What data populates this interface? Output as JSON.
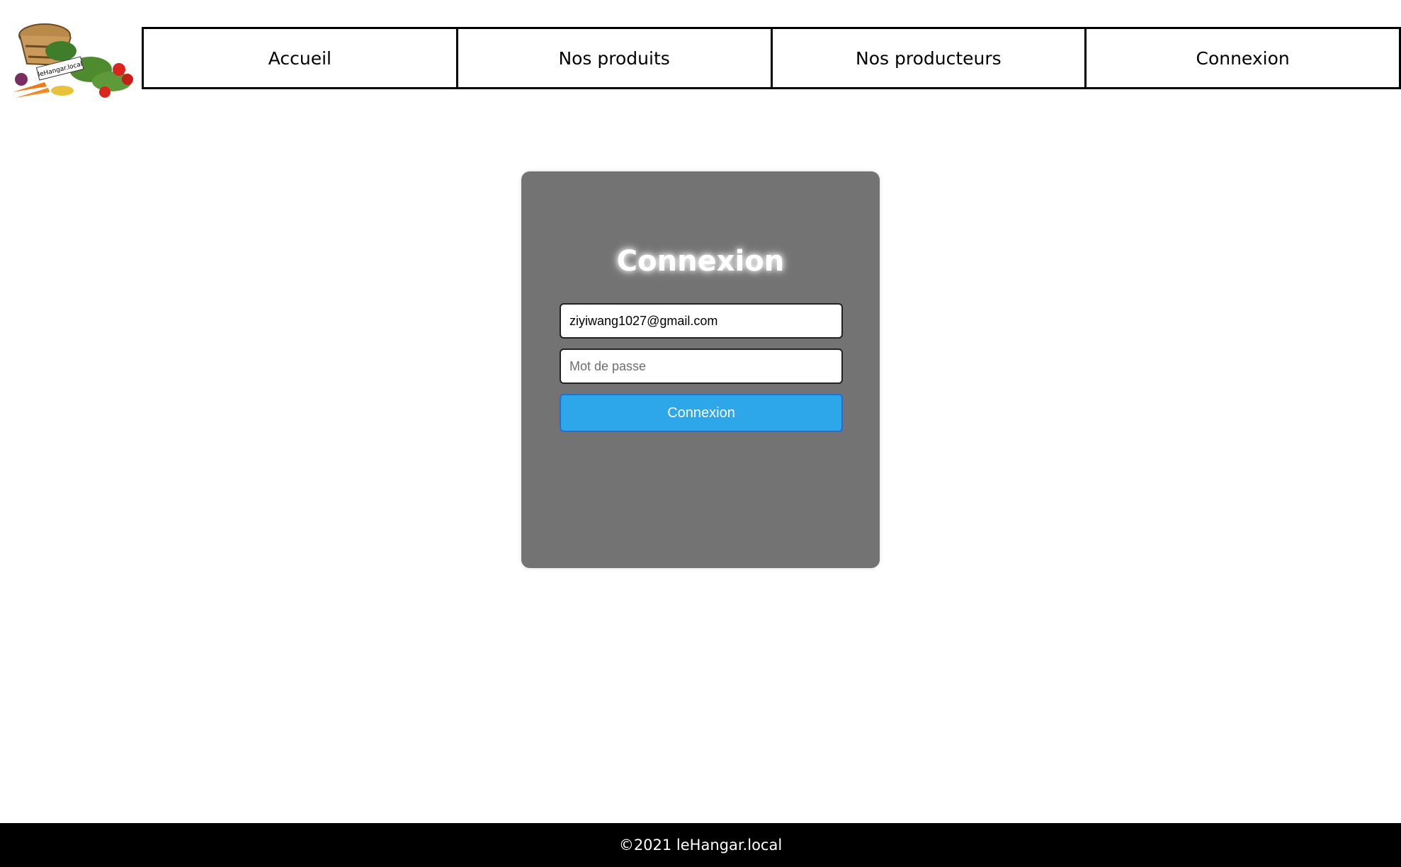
{
  "header": {
    "logo_text": "leHangar.local",
    "nav": [
      {
        "label": "Accueil"
      },
      {
        "label": "Nos produits"
      },
      {
        "label": "Nos producteurs"
      },
      {
        "label": "Connexion"
      }
    ]
  },
  "login": {
    "title": "Connexion",
    "email_value": "ziyiwang1027@gmail.com",
    "password_placeholder": "Mot de passe",
    "submit_label": "Connexion"
  },
  "footer": {
    "text": "©2021 leHangar.local"
  },
  "colors": {
    "card_background": "#737373",
    "button_background": "#2ea6ea",
    "footer_background": "#000000"
  }
}
